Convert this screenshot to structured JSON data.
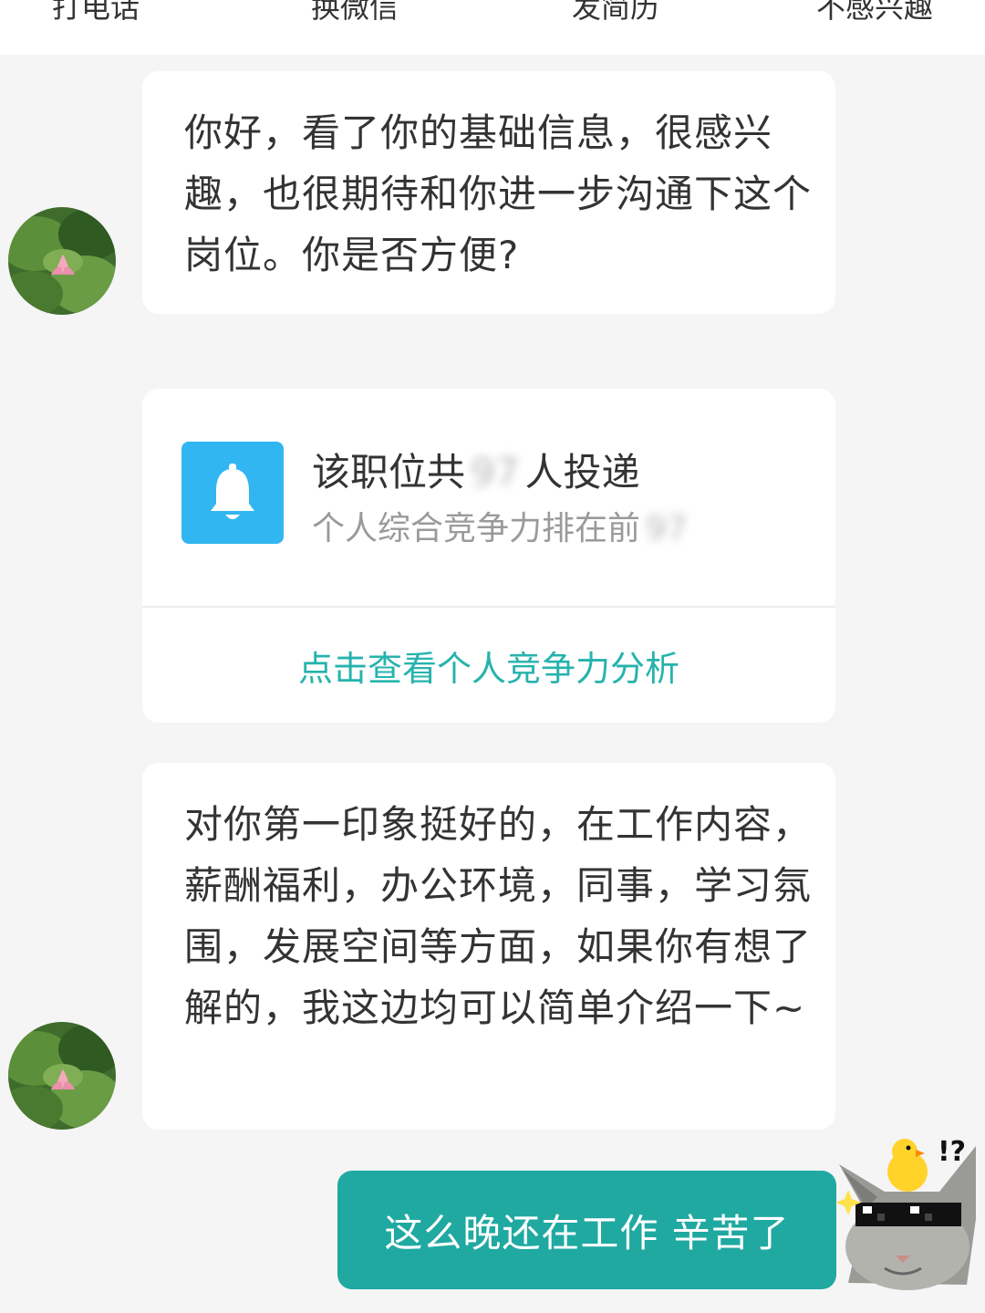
{
  "top_actions": {
    "call": "打电话",
    "wechat": "换微信",
    "resume": "发简历",
    "not_interested": "不感兴趣"
  },
  "messages": [
    {
      "text": "你好，看了你的基础信息，很感兴趣，也很期待和你进一步沟通下这个岗位。你是否方便?"
    },
    {
      "text": "对你第一印象挺好的，在工作内容，薪酬福利，办公环境，同事，学习氛围，发展空间等方面，如果你有想了解的，我这边均可以简单介绍一下~"
    }
  ],
  "competition_card": {
    "title_prefix": "该职位共",
    "applicant_count": "97",
    "title_suffix": "人投递",
    "rank_prefix": "个人综合竞争力排在前",
    "rank_value": "97",
    "link_label": "点击查看个人竞争力分析",
    "icon": "bell-icon"
  },
  "my_message": {
    "text": "这么晚还在工作 辛苦了"
  },
  "colors": {
    "accent": "#1fa9a1",
    "link": "#26b3ad",
    "bell_bg": "#31b6f2",
    "background": "#f5f5f5"
  }
}
